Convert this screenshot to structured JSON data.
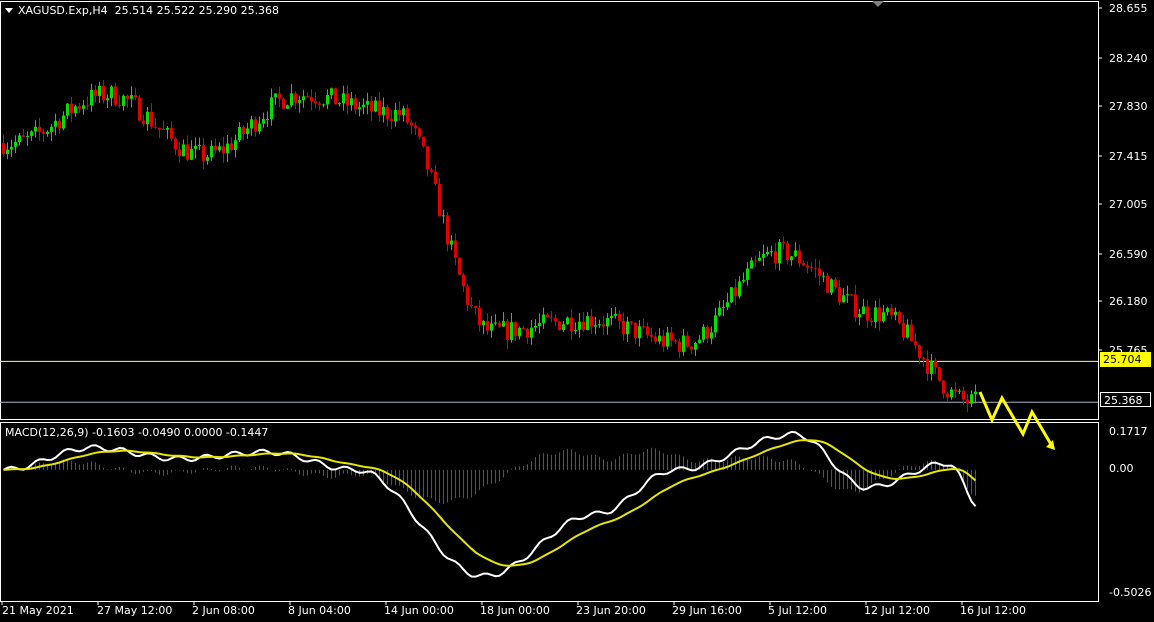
{
  "header": {
    "symbol": "XAGUSD.Exp,H4",
    "ohlc": "25.514 25.522 25.290 25.368"
  },
  "macd": {
    "label": "MACD(12,26,9) -0.1603 -0.0490 0.0000 -0.1447",
    "ticks": [
      "0.1717",
      "0.00",
      "-0.5026"
    ]
  },
  "price_axis": {
    "ticks": [
      "28.655",
      "28.240",
      "27.830",
      "27.415",
      "27.005",
      "26.590",
      "26.180",
      "25.765"
    ],
    "levels": {
      "support": "25.704",
      "bid": "25.368"
    }
  },
  "time_axis": {
    "ticks": [
      "21 May 2021",
      "27 May 12:00",
      "2 Jun 08:00",
      "8 Jun 04:00",
      "14 Jun 00:00",
      "18 Jun 00:00",
      "23 Jun 20:00",
      "29 Jun 16:00",
      "5 Jul 12:00",
      "12 Jul 12:00",
      "16 Jul 12:00"
    ]
  },
  "colors": {
    "bg": "#000000",
    "bull": "#00e000",
    "bear": "#e00000",
    "frame": "#ffffff",
    "level_line": "#ffff80",
    "bid_line": "#aab4c8",
    "macd_line": "#ffffff",
    "signal_line": "#e6e600",
    "forecast_arrow": "#ffff00",
    "hist_up": "#b03030",
    "hist_down": "#1f7a1f"
  },
  "icons": {
    "menu": "triangle-down-icon",
    "forecast": "zigzag-arrow-icon"
  },
  "chart_data": {
    "type": "candlestick",
    "title": "XAGUSD.Exp,H4",
    "ylim": [
      25.23,
      28.67
    ],
    "levels": [
      25.704,
      25.368
    ],
    "key_closes": [
      {
        "label": "21 May 2021",
        "value": 27.5
      },
      {
        "label": "27 May 12:00",
        "value": 27.9
      },
      {
        "label": "2 Jun 08:00",
        "value": 27.4
      },
      {
        "label": "8 Jun 04:00",
        "value": 27.9
      },
      {
        "label": "14 Jun 00:00",
        "value": 27.75
      },
      {
        "label": "18 Jun 00:00",
        "value": 25.95
      },
      {
        "label": "23 Jun 20:00",
        "value": 26.05
      },
      {
        "label": "29 Jun 16:00",
        "value": 25.85
      },
      {
        "label": "5 Jul 12:00",
        "value": 26.6
      },
      {
        "label": "12 Jul 12:00",
        "value": 26.1
      },
      {
        "label": "16 Jul 12:00",
        "value": 25.37
      }
    ],
    "macd": {
      "main": -0.1603,
      "signal": -0.049,
      "ylim": [
        -0.52,
        0.18
      ]
    }
  }
}
